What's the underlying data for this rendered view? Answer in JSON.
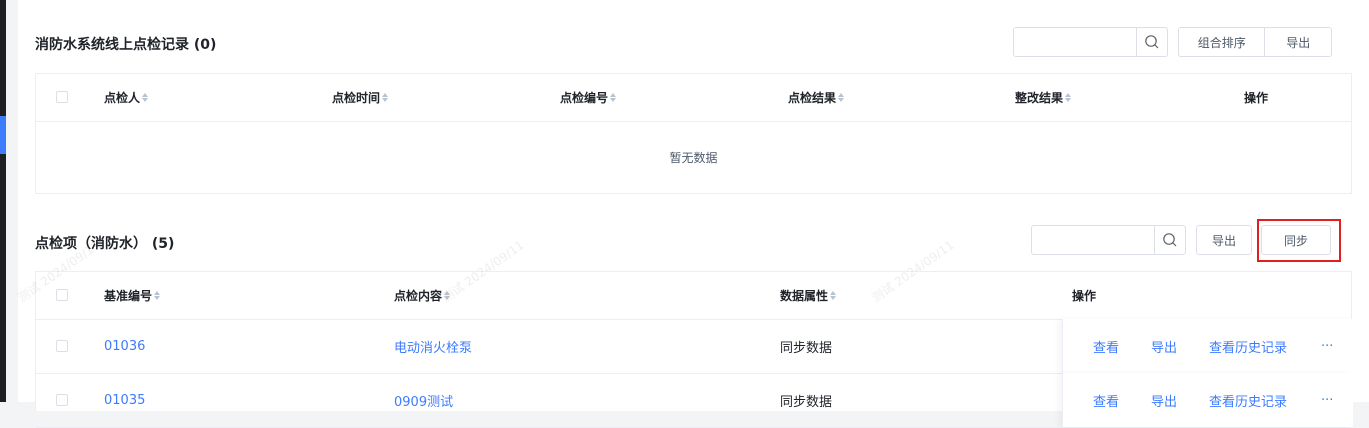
{
  "section1": {
    "title": "消防水系统线上点检记录 (0)",
    "search_value": "",
    "buttons": {
      "combined_sort": "组合排序",
      "export": "导出"
    },
    "columns": [
      "点检人",
      "点检时间",
      "点检编号",
      "点检结果",
      "整改结果",
      "操作"
    ],
    "empty_text": "暂无数据"
  },
  "section2": {
    "title": "点检项（消防水） (5)",
    "search_value": "",
    "buttons": {
      "export": "导出",
      "sync": "同步"
    },
    "columns": [
      "基准编号",
      "点检内容",
      "数据属性",
      "操作"
    ],
    "rows": [
      {
        "code": "01036",
        "content": "电动消火栓泵",
        "attr": "同步数据"
      },
      {
        "code": "01035",
        "content": "0909测试",
        "attr": "同步数据"
      }
    ],
    "row_actions": {
      "view": "查看",
      "export": "导出",
      "history": "查看历史记录",
      "more": "···"
    }
  },
  "watermark_text": "测试 2024/09/11",
  "colors": {
    "accent": "#3d7bff",
    "highlight": "#e02020"
  }
}
